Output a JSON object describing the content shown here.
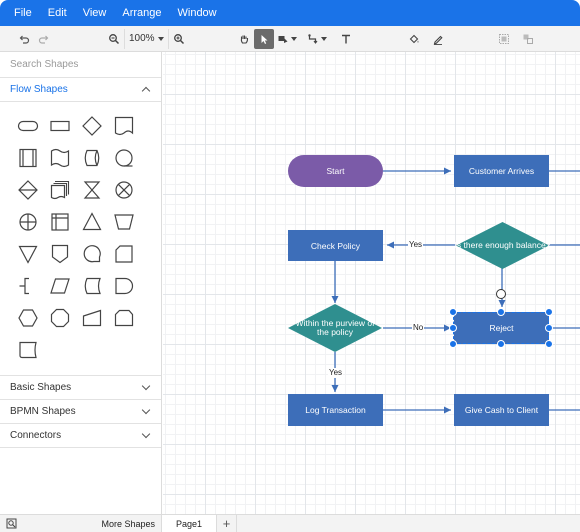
{
  "menu": [
    "File",
    "Edit",
    "View",
    "Arrange",
    "Window"
  ],
  "toolbar": {
    "zoom": "100%"
  },
  "sidebar": {
    "search_placeholder": "Search Shapes",
    "flow_shapes_label": "Flow Shapes",
    "basic_shapes_label": "Basic Shapes",
    "bpmn_shapes_label": "BPMN Shapes",
    "connectors_label": "Connectors"
  },
  "diagram": {
    "nodes": {
      "start": "Start",
      "customer_arrives": "Customer Arrives",
      "enough_balance": "Is there enough balance?",
      "check_policy": "Check Policy",
      "within_purview": "Within the purview of the policy",
      "reject": "Reject",
      "log_transaction": "Log Transaction",
      "give_cash": "Give Cash to Client"
    },
    "labels": {
      "yes_1": "Yes",
      "no_1": "No",
      "yes_2": "Yes"
    }
  },
  "footer": {
    "more_shapes": "More Shapes",
    "page_tab": "Page1"
  },
  "colors": {
    "accent": "#1a73e8",
    "process": "#3d6eb9",
    "decision": "#2f8f8f",
    "terminator": "#7b5ba8"
  }
}
